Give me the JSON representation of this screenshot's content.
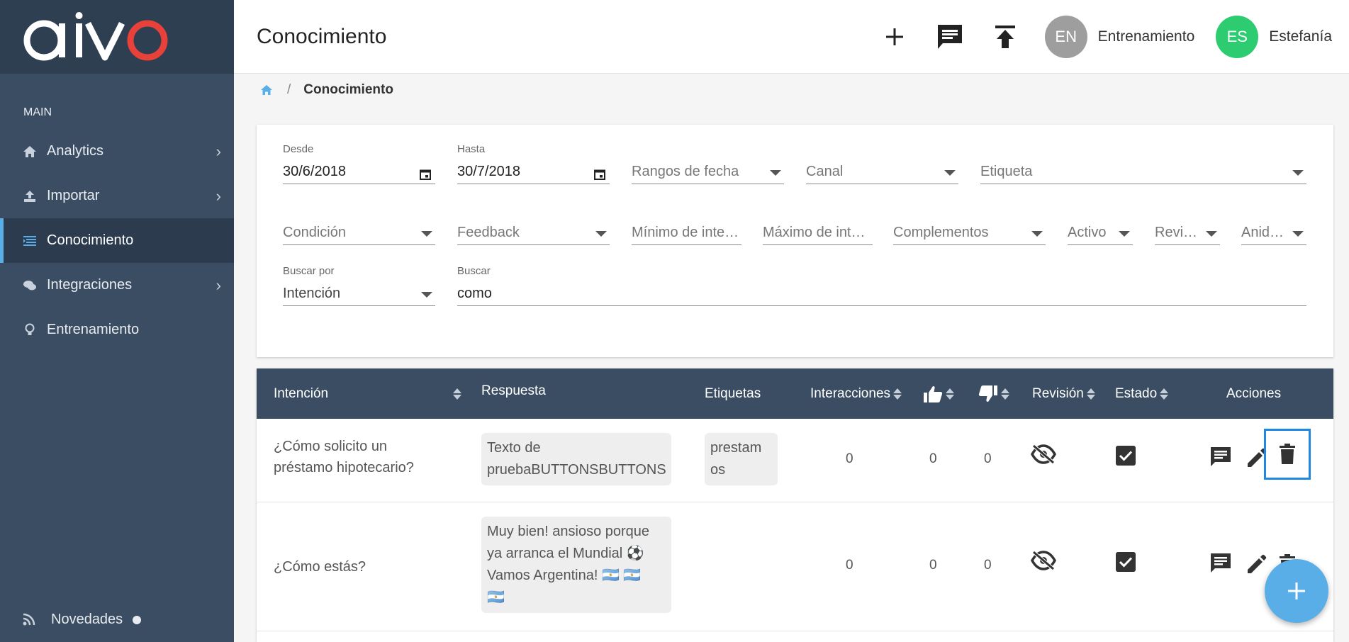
{
  "brand": {
    "logo_main": "ai",
    "logo_v": "v",
    "logo_o": "o"
  },
  "sidebar": {
    "section": "MAIN",
    "items": [
      {
        "label": "Analytics",
        "icon": "home-icon",
        "has_chevron": true
      },
      {
        "label": "Importar",
        "icon": "upload-icon",
        "has_chevron": true
      },
      {
        "label": "Conocimiento",
        "icon": "list-icon",
        "active": true
      },
      {
        "label": "Integraciones",
        "icon": "chat-bubbles-icon",
        "has_chevron": true
      },
      {
        "label": "Entrenamiento",
        "icon": "lightbulb-icon"
      }
    ],
    "bottom": {
      "label": "Novedades",
      "icon": "rss-icon"
    }
  },
  "header": {
    "title": "Conocimiento",
    "users": [
      {
        "initials": "EN",
        "name": "Entrenamiento",
        "color": "#9e9e9e"
      },
      {
        "initials": "ES",
        "name": "Estefanía",
        "color": "#2ecc71"
      }
    ]
  },
  "breadcrumb": {
    "separator": "/",
    "current": "Conocimiento"
  },
  "filters": {
    "desde": {
      "label": "Desde",
      "value": "30/6/2018"
    },
    "hasta": {
      "label": "Hasta",
      "value": "30/7/2018"
    },
    "rangos": "Rangos de fecha",
    "canal": "Canal",
    "etiqueta": "Etiqueta",
    "condicion": "Condición",
    "feedback": "Feedback",
    "minimo": "Mínimo de interacciones",
    "maximo": "Máximo de interacciones",
    "complementos": "Complementos",
    "activo": "Activo",
    "revision": "Revisión",
    "anidadas": "Anidadas",
    "buscar_por": {
      "label": "Buscar por",
      "value": "Intención"
    },
    "buscar": {
      "label": "Buscar",
      "value": "como"
    }
  },
  "table": {
    "columns": {
      "intencion": "Intención",
      "respuesta": "Respuesta",
      "etiquetas": "Etiquetas",
      "interacciones": "Interacciones",
      "revision": "Revisión",
      "estado": "Estado",
      "acciones": "Acciones"
    },
    "rows": [
      {
        "intent_line1": "¿Cómo solicito un",
        "intent_line2": "préstamo hipotecario?",
        "response_line1": "Texto de",
        "response_line2": "pruebaBUTTONSBUTTONS",
        "tag_line1": "prestam",
        "tag_line2": "os",
        "interacciones": "0",
        "likes": "0",
        "dislikes": "0"
      },
      {
        "intent_line1": "¿Cómo estás?",
        "response_line1": "Muy bien! ansioso porque",
        "response_line2": "ya arranca el Mundial ⚽",
        "response_line3": "Vamos Argentina! 🇦🇷 🇦🇷",
        "response_line4": "🇦🇷",
        "interacciones": "0",
        "likes": "0",
        "dislikes": "0"
      }
    ]
  },
  "colors": {
    "sidebar": "#3b4d63",
    "accent": "#5aaee8",
    "brand_o": "#e8413a"
  }
}
